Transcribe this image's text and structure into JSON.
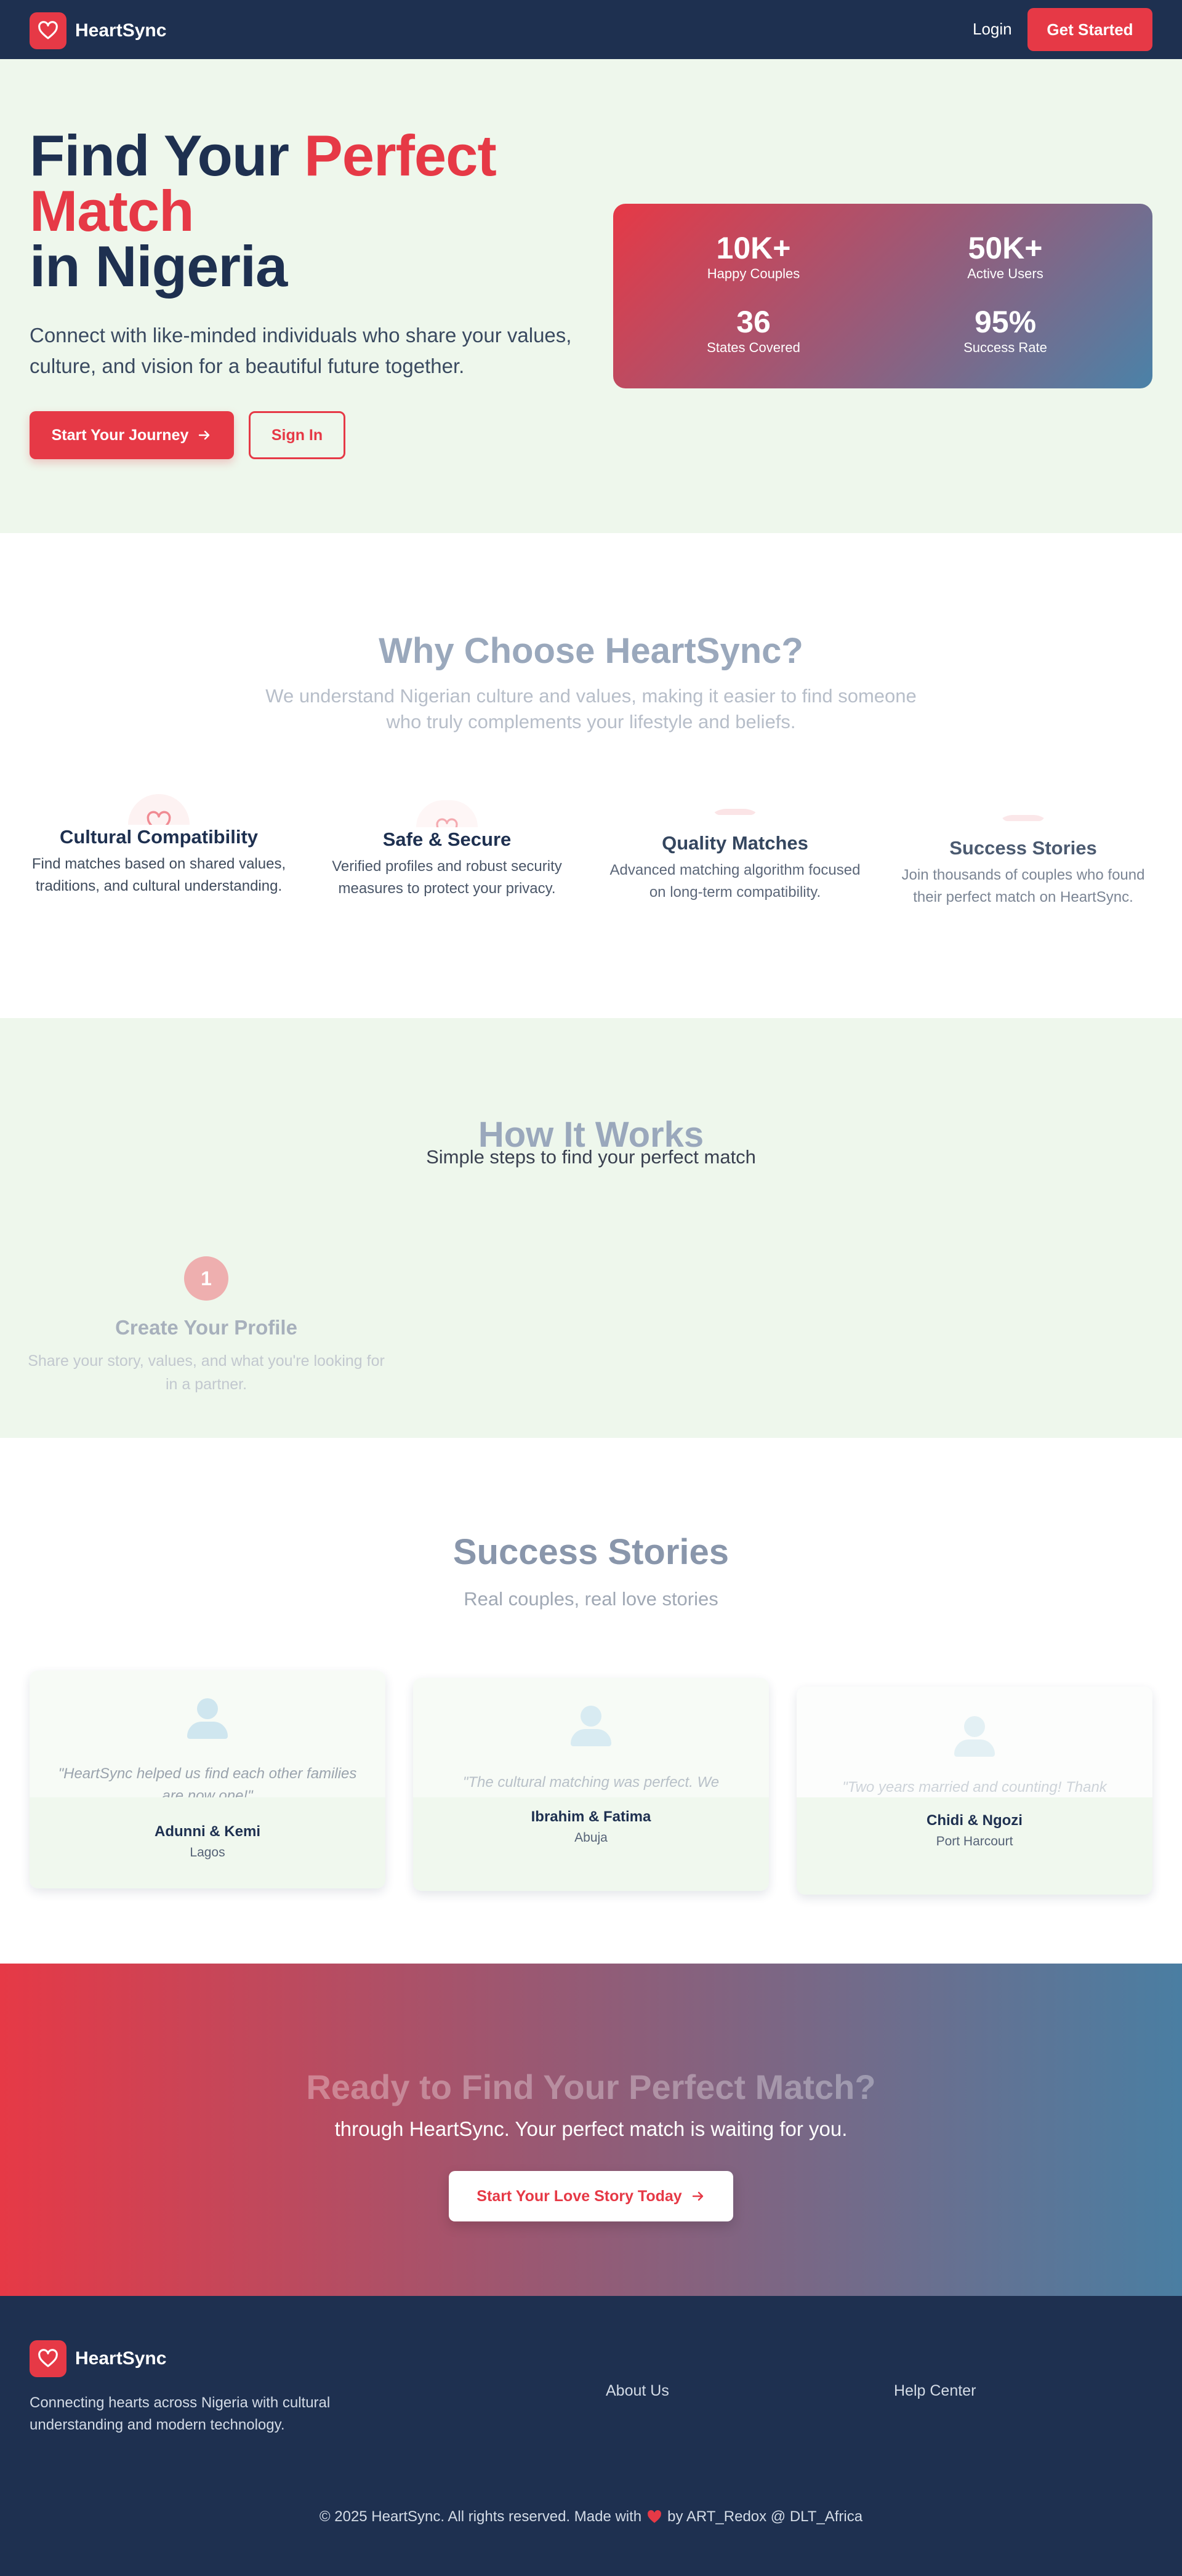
{
  "nav": {
    "brand": "HeartSync",
    "login": "Login",
    "cta": "Get Started"
  },
  "hero": {
    "title_part1": "Find Your ",
    "title_accent": "Perfect Match",
    "title_part2": "in Nigeria",
    "subtitle": "Connect with like-minded individuals who share your values, culture, and vision for a beautiful future together.",
    "primary_button": "Start Your Journey",
    "secondary_button": "Sign In",
    "stats": [
      {
        "value": "10K+",
        "label": "Happy Couples"
      },
      {
        "value": "50K+",
        "label": "Active Users"
      },
      {
        "value": "36",
        "label": "States Covered"
      },
      {
        "value": "95%",
        "label": "Success Rate"
      }
    ]
  },
  "why": {
    "title": "Why Choose HeartSync?",
    "subtitle": "We understand Nigerian culture and values, making it easier to find someone who truly complements your lifestyle and beliefs.",
    "features": [
      {
        "icon": "heart-icon",
        "title": "Cultural Compatibility",
        "description": "Find matches based on shared values, traditions, and cultural understanding."
      },
      {
        "icon": "heart-icon",
        "title": "Safe & Secure",
        "description": "Verified profiles and robust security measures to protect your privacy."
      },
      {
        "icon": "heart-icon",
        "title": "Quality Matches",
        "description": "Advanced matching algorithm focused on long-term compatibility."
      },
      {
        "icon": "heart-icon",
        "title": "Success Stories",
        "description": "Join thousands of couples who found their perfect match on HeartSync."
      }
    ]
  },
  "how": {
    "title": "How It Works",
    "subtitle": "Simple steps to find your perfect match",
    "steps": [
      {
        "number": "1",
        "title": "Create Your Profile",
        "description": "Share your story, values, and what you're looking for in a partner."
      }
    ]
  },
  "stories": {
    "title": "Success Stories",
    "subtitle": "Real couples, real love stories",
    "cards": [
      {
        "quote": "\"HeartSync helped us find each other families are now one!\"",
        "name": "Adunni & Kemi",
        "location": "Lagos"
      },
      {
        "quote": "\"The cultural matching was perfect. We",
        "name": "Ibrahim & Fatima",
        "location": "Abuja"
      },
      {
        "quote": "\"Two years married and counting! Thank",
        "name": "Chidi & Ngozi",
        "location": "Port Harcourt"
      }
    ]
  },
  "cta": {
    "title": "Ready to Find Your Perfect Match?",
    "subtitle": "through HeartSync. Your perfect match is waiting for you.",
    "button": "Start Your Love Story Today"
  },
  "footer": {
    "brand": "HeartSync",
    "description": "Connecting hearts across Nigeria with cultural understanding and modern technology.",
    "links": [
      "About Us",
      "Help Center"
    ],
    "copyright_before": "© 2025 HeartSync. All rights reserved. Made with",
    "copyright_after": "by ART_Redox @ DLT_Africa"
  },
  "colors": {
    "navy": "#1e3050",
    "accent": "#e63946",
    "mint": "#eef7ec",
    "steel_blue": "#4a82a8"
  }
}
